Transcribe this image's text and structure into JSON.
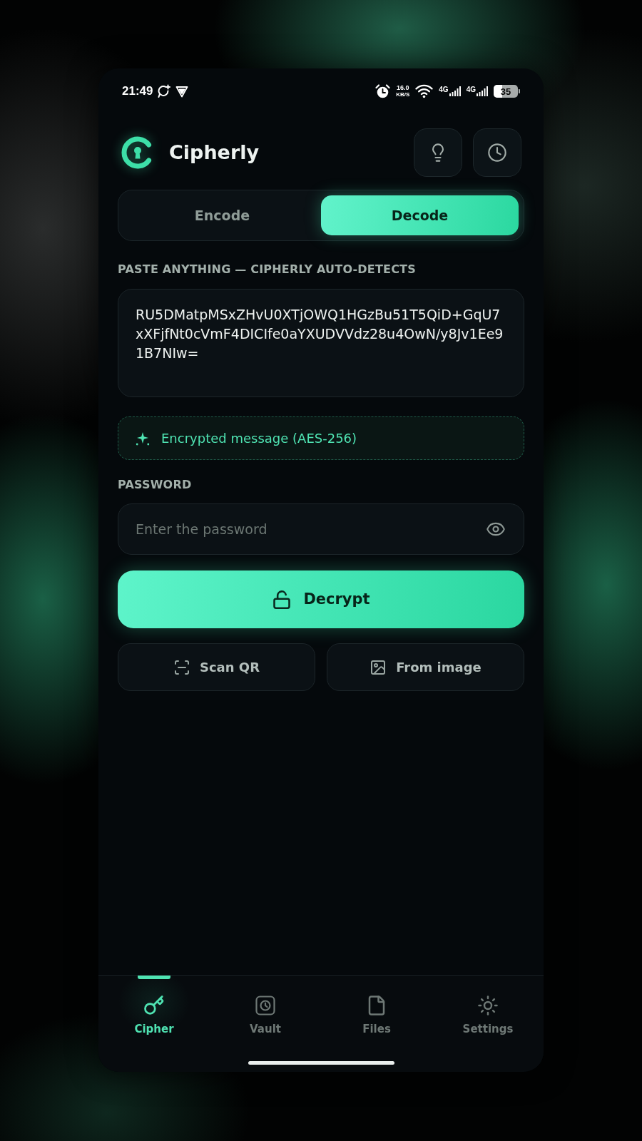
{
  "status_bar": {
    "time": "21:49",
    "net_speed": {
      "value": "16.0",
      "unit": "KB/S"
    },
    "networks": [
      "4G",
      "4G"
    ],
    "battery": "35"
  },
  "header": {
    "title": "Cipherly"
  },
  "tabs": [
    {
      "label": "Encode",
      "selected": false
    },
    {
      "label": "Decode",
      "selected": true
    }
  ],
  "input": {
    "label": "PASTE ANYTHING — CIPHERLY AUTO-DETECTS",
    "value": "RU5DMatpMSxZHvU0XTjOWQ1HGzBu51T5QiD+GqU7xXFjfNt0cVmF4DICIfe0aYXUDVVdz28u4OwN/y8Jv1Ee91B7NIw="
  },
  "detection": {
    "text": "Encrypted message (AES-256)"
  },
  "password": {
    "label": "PASSWORD",
    "placeholder": "Enter the password"
  },
  "primary_button": {
    "label": "Decrypt"
  },
  "actions": [
    {
      "label": "Scan QR"
    },
    {
      "label": "From image"
    }
  ],
  "nav": [
    {
      "label": "Cipher",
      "selected": true
    },
    {
      "label": "Vault",
      "selected": false
    },
    {
      "label": "Files",
      "selected": false
    },
    {
      "label": "Settings",
      "selected": false
    }
  ]
}
